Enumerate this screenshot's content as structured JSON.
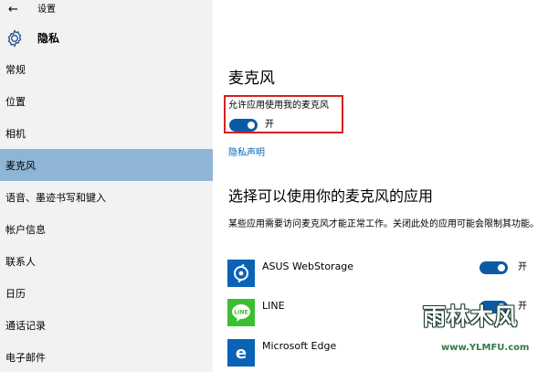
{
  "window": {
    "title": "设置",
    "back_icon": "back-arrow-icon"
  },
  "header": {
    "title": "隐私",
    "icon": "gear-icon"
  },
  "sidebar": {
    "items": [
      {
        "label": "常规",
        "active": false
      },
      {
        "label": "位置",
        "active": false
      },
      {
        "label": "相机",
        "active": false
      },
      {
        "label": "麦克风",
        "active": true
      },
      {
        "label": "语音、墨迹书写和键入",
        "active": false
      },
      {
        "label": "帐户信息",
        "active": false
      },
      {
        "label": "联系人",
        "active": false
      },
      {
        "label": "日历",
        "active": false
      },
      {
        "label": "通话记录",
        "active": false
      },
      {
        "label": "电子邮件",
        "active": false
      }
    ]
  },
  "main": {
    "title": "麦克风",
    "master_toggle": {
      "label": "允许应用使用我的麦克风",
      "state_text": "开",
      "on": true
    },
    "privacy_link": "隐私声明",
    "apps_heading": "选择可以使用你的麦克风的应用",
    "apps_description": "某些应用需要访问麦克风才能正常工作。关闭此处的应用可能会限制其功能。",
    "apps": [
      {
        "name": "ASUS WebStorage",
        "icon": "asus-webstorage-icon",
        "color": "#0b63b6",
        "state_text": "开",
        "on": true
      },
      {
        "name": "LINE",
        "icon": "line-icon",
        "color": "#3bbf32",
        "state_text": "开",
        "on": true
      },
      {
        "name": "Microsoft Edge",
        "icon": "edge-icon",
        "color": "#0b63b6",
        "state_text": "",
        "on": true
      }
    ]
  },
  "colors": {
    "accent": "#0c5aa6",
    "link": "#0067b8",
    "highlight_box": "#d62021",
    "sidebar_bg": "#f2f2f2",
    "active_item": "#8fb5d6"
  },
  "watermark": {
    "text": "雨林木风",
    "url": "www.YLMFU.com"
  }
}
